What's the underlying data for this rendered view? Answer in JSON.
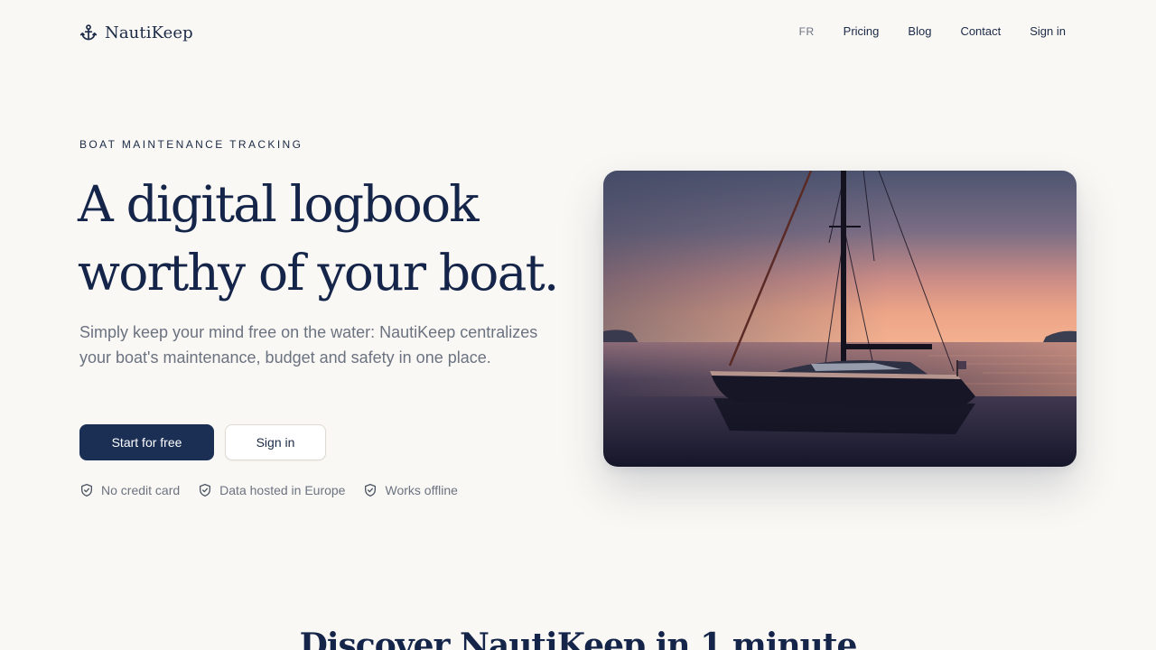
{
  "nav": {
    "brand": "NautiKeep",
    "links": {
      "lang": "FR",
      "pricing": "Pricing",
      "blog": "Blog",
      "contact": "Contact",
      "signin": "Sign in"
    }
  },
  "hero": {
    "eyebrow": "BOAT MAINTENANCE TRACKING",
    "title_line1": "A digital logbook",
    "title_line2": "worthy of your boat.",
    "subtitle": "Simply keep your mind free on the water: NautiKeep centralizes your boat's maintenance, budget and safety in one place.",
    "cta_primary": "Start for free",
    "cta_secondary": "Sign in",
    "badges": [
      {
        "icon": "shield-check-icon",
        "text": "No credit card"
      },
      {
        "icon": "shield-check-icon",
        "text": "Data hosted in Europe"
      },
      {
        "icon": "shield-check-icon",
        "text": "Works offline"
      }
    ]
  },
  "next_section": {
    "title": "Discover NautiKeep in 1 minute"
  },
  "colors": {
    "background": "#faf8f4",
    "navy": "#1b2f55",
    "muted": "#6b7280"
  }
}
